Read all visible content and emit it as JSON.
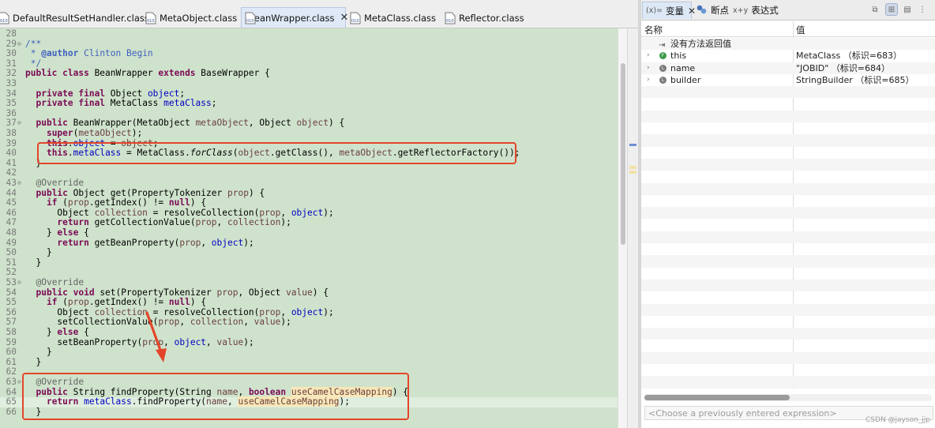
{
  "editor": {
    "tabs": [
      {
        "label": "DefaultResultSetHandler.class",
        "active": false
      },
      {
        "label": "MetaObject.class",
        "active": false
      },
      {
        "label": "BeanWrapper.class",
        "active": true
      },
      {
        "label": "MetaClass.class",
        "active": false
      },
      {
        "label": "Reflector.class",
        "active": false
      }
    ],
    "close_symbol": "✕",
    "lines": [
      {
        "n": "28",
        "html": ""
      },
      {
        "n": "29",
        "fold": "⊖",
        "html": "<span class=\"cm\">/**</span>"
      },
      {
        "n": "30",
        "html": "<span class=\"cm\"> * <b>@author</b> Clinton Begin</span>"
      },
      {
        "n": "31",
        "html": "<span class=\"cm\"> */</span>"
      },
      {
        "n": "32",
        "html": "<span class=\"kw\">public class</span> BeanWrapper <span class=\"kw\">extends</span> BaseWrapper {"
      },
      {
        "n": "33",
        "html": ""
      },
      {
        "n": "34",
        "html": "  <span class=\"kw\">private final</span> Object <span class=\"fld\">object</span>;"
      },
      {
        "n": "35",
        "html": "  <span class=\"kw\">private final</span> MetaClass <span class=\"fld\">metaClass</span>;"
      },
      {
        "n": "36",
        "html": ""
      },
      {
        "n": "37",
        "fold": "⊖",
        "html": "  <span class=\"kw\">public</span> BeanWrapper(MetaObject <span class=\"var\">metaObject</span>, Object <span class=\"var\">object</span>) {"
      },
      {
        "n": "38",
        "html": "    <span class=\"kw\">super</span>(<span class=\"var\">metaObject</span>);"
      },
      {
        "n": "39",
        "html": "    <span class=\"strike\"><span class=\"kw\">this</span>.<span class=\"fld\">object</span> = <span class=\"var\">object</span>;</span>"
      },
      {
        "n": "40",
        "html": "    <span class=\"kw\">this</span>.<span class=\"fld\">metaClass</span> = MetaClass.<span class=\"it\">forClass</span>(<span class=\"var\">object</span>.getClass(), <span class=\"var\">metaObject</span>.getReflectorFactory());"
      },
      {
        "n": "41",
        "html": "  }"
      },
      {
        "n": "42",
        "html": ""
      },
      {
        "n": "43",
        "fold": "⊖",
        "html": "  <span class=\"ann\">@Override</span>"
      },
      {
        "n": "44",
        "html": "  <span class=\"kw\">public</span> Object get(PropertyTokenizer <span class=\"var\">prop</span>) {"
      },
      {
        "n": "45",
        "html": "    <span class=\"kw\">if</span> (<span class=\"var\">prop</span>.getIndex() != <span class=\"kw\">null</span>) {"
      },
      {
        "n": "46",
        "html": "      Object <span class=\"var\">collection</span> = resolveCollection(<span class=\"var\">prop</span>, <span class=\"fld\">object</span>);"
      },
      {
        "n": "47",
        "html": "      <span class=\"kw\">return</span> getCollectionValue(<span class=\"var\">prop</span>, <span class=\"var\">collection</span>);"
      },
      {
        "n": "48",
        "html": "    } <span class=\"kw\">else</span> {"
      },
      {
        "n": "49",
        "html": "      <span class=\"kw\">return</span> getBeanProperty(<span class=\"var\">prop</span>, <span class=\"fld\">object</span>);"
      },
      {
        "n": "50",
        "html": "    }"
      },
      {
        "n": "51",
        "html": "  }"
      },
      {
        "n": "52",
        "html": ""
      },
      {
        "n": "53",
        "fold": "⊖",
        "html": "  <span class=\"ann\">@Override</span>"
      },
      {
        "n": "54",
        "html": "  <span class=\"kw\">public void</span> set(PropertyTokenizer <span class=\"var\">prop</span>, Object <span class=\"var\">value</span>) {"
      },
      {
        "n": "55",
        "html": "    <span class=\"kw\">if</span> (<span class=\"var\">prop</span>.getIndex() != <span class=\"kw\">null</span>) {"
      },
      {
        "n": "56",
        "html": "      Object <span class=\"var\">collection</span> = resolveCollection(<span class=\"var\">prop</span>, <span class=\"fld\">object</span>);"
      },
      {
        "n": "57",
        "html": "      setCollectionValue(<span class=\"var\">prop</span>, <span class=\"var\">collection</span>, <span class=\"var\">value</span>);"
      },
      {
        "n": "58",
        "html": "    } <span class=\"kw\">else</span> {"
      },
      {
        "n": "59",
        "html": "      setBeanProperty(<span class=\"var\">prop</span>, <span class=\"fld\">object</span>, <span class=\"var\">value</span>);"
      },
      {
        "n": "60",
        "html": "    }"
      },
      {
        "n": "61",
        "html": "  }"
      },
      {
        "n": "62",
        "html": ""
      },
      {
        "n": "63",
        "fold": "⊖",
        "html": "  <span class=\"ann\">@Override</span>"
      },
      {
        "n": "64",
        "html": "  <span class=\"kw\">public</span> String findProperty(String <span class=\"var\">name</span>, <span class=\"kw\">boolean</span> <span class=\"var hl\">useCamelCaseMapping</span>) {"
      },
      {
        "n": "65",
        "current": true,
        "html": "    <span class=\"kw\">return</span> <span class=\"fld\">metaClass</span>.findProperty(<span class=\"var\">name</span>, <span class=\"var hl\">useCamelCaseMapping</span>);"
      },
      {
        "n": "66",
        "html": "  }"
      }
    ]
  },
  "variables": {
    "tabs": [
      {
        "icon_text": "(x)=",
        "label": "变量",
        "active": true
      },
      {
        "icon": "breakpoints-icon",
        "label": "断点"
      },
      {
        "icon_text": "x+y",
        "label": "表达式"
      }
    ],
    "columns": {
      "name": "名称",
      "value": "值"
    },
    "rows": [
      {
        "name": "没有方法返回值",
        "value": "",
        "icon": "return-icon"
      },
      {
        "name": "this",
        "value": "MetaClass  （标识=683）",
        "icon": "field-icon",
        "expandable": true,
        "icon_color": "#3a9a4a",
        "icon_text": "F"
      },
      {
        "name": "name",
        "value": "\"JOBID\"  （标识=684）",
        "icon": "local-variable-icon",
        "expandable": true,
        "icon_color": "#7a7a7a",
        "icon_text": "L"
      },
      {
        "name": "builder",
        "value": "StringBuilder   （标识=685）",
        "icon": "local-variable-icon",
        "expandable": true,
        "icon_color": "#7a7a7a",
        "icon_text": "L"
      }
    ],
    "expression_placeholder": "<Choose a previously entered expression>"
  },
  "watermark": "CSDN @jayson_jjp",
  "colors": {
    "annotation_box": "#e4452a",
    "arrow": "#e4452a",
    "editor_bg": "#cfe3cc"
  }
}
